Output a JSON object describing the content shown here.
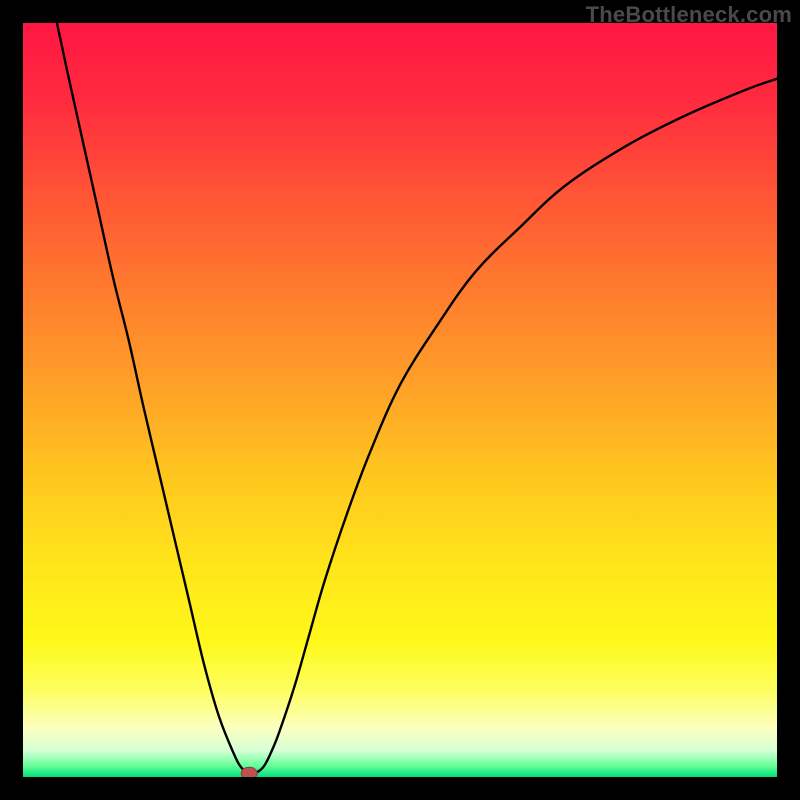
{
  "watermark": {
    "text": "TheBottleneck.com"
  },
  "colors": {
    "black": "#000000",
    "curve": "#000000",
    "marker_fill": "#c0504d",
    "marker_stroke": "#8a3a38",
    "grad_stops": [
      {
        "offset": 0.0,
        "color": "#ff1644"
      },
      {
        "offset": 0.1,
        "color": "#ff2a3f"
      },
      {
        "offset": 0.22,
        "color": "#ff5236"
      },
      {
        "offset": 0.35,
        "color": "#ff7a2e"
      },
      {
        "offset": 0.48,
        "color": "#ffa028"
      },
      {
        "offset": 0.6,
        "color": "#ffc61f"
      },
      {
        "offset": 0.72,
        "color": "#ffe51a"
      },
      {
        "offset": 0.82,
        "color": "#fff81a"
      },
      {
        "offset": 0.885,
        "color": "#fdff60"
      },
      {
        "offset": 0.935,
        "color": "#fcffc0"
      },
      {
        "offset": 0.965,
        "color": "#d6ffd6"
      },
      {
        "offset": 0.985,
        "color": "#66ff99"
      },
      {
        "offset": 1.0,
        "color": "#00e07a"
      }
    ]
  },
  "chart_data": {
    "type": "line",
    "title": "",
    "xlabel": "",
    "ylabel": "",
    "xlim": [
      0,
      100
    ],
    "ylim": [
      0,
      100
    ],
    "grid": false,
    "series": [
      {
        "name": "curve",
        "x": [
          4.5,
          6,
          8,
          10,
          12,
          14,
          16,
          18,
          20,
          22,
          24,
          26,
          28,
          29,
          30,
          31,
          32,
          33,
          34,
          36,
          38,
          40,
          43,
          46,
          50,
          55,
          60,
          66,
          72,
          80,
          88,
          96,
          100
        ],
        "y": [
          100,
          93,
          84,
          75,
          66,
          58,
          49,
          40.5,
          32,
          23.5,
          15,
          8,
          3,
          1.2,
          0.4,
          0.6,
          1.5,
          3.5,
          6,
          12,
          19,
          26,
          35,
          43,
          52,
          60,
          67,
          73,
          78.5,
          83.7,
          87.8,
          91.2,
          92.6
        ]
      }
    ],
    "marker": {
      "x": 30,
      "y": 0.5
    }
  }
}
